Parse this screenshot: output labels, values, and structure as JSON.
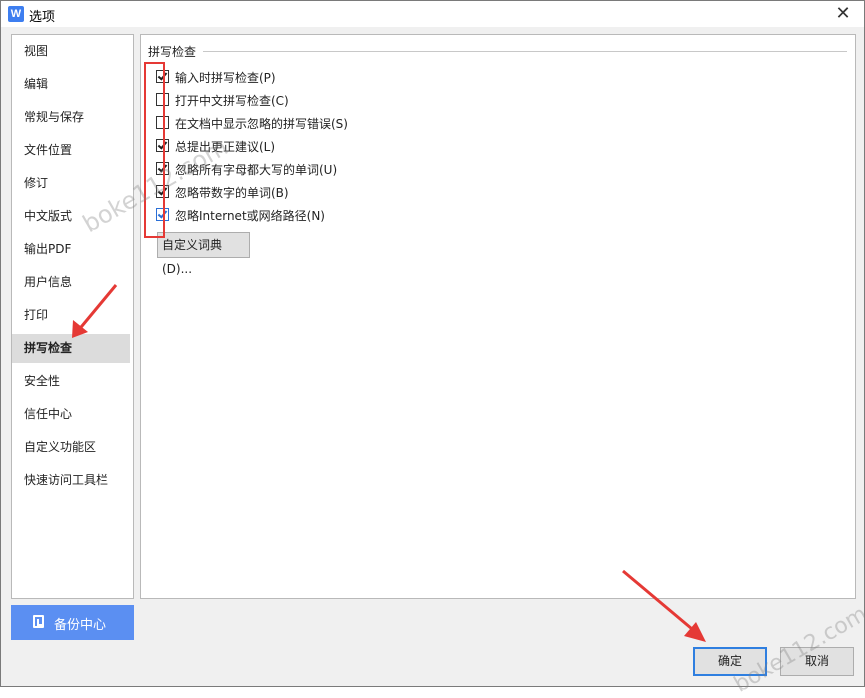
{
  "window": {
    "title": "选项",
    "app_icon": "W",
    "close_glyph": "✕"
  },
  "sidebar": {
    "items": [
      {
        "label": "视图"
      },
      {
        "label": "编辑"
      },
      {
        "label": "常规与保存"
      },
      {
        "label": "文件位置"
      },
      {
        "label": "修订"
      },
      {
        "label": "中文版式"
      },
      {
        "label": "输出PDF"
      },
      {
        "label": "用户信息"
      },
      {
        "label": "打印"
      },
      {
        "label": "拼写检查",
        "active": true
      },
      {
        "label": "安全性"
      },
      {
        "label": "信任中心"
      },
      {
        "label": "自定义功能区"
      },
      {
        "label": "快速访问工具栏"
      }
    ],
    "backup_button": "备份中心"
  },
  "spellcheck": {
    "group_title": "拼写检查",
    "options": [
      {
        "label": "输入时拼写检查(P)",
        "checked": true
      },
      {
        "label": "打开中文拼写检查(C)",
        "checked": false
      },
      {
        "label": "在文档中显示忽略的拼写错误(S)",
        "checked": false
      },
      {
        "label": "总提出更正建议(L)",
        "checked": true
      },
      {
        "label": "忽略所有字母都大写的单词(U)",
        "checked": true
      },
      {
        "label": "忽略带数字的单词(B)",
        "checked": true
      },
      {
        "label": "忽略Internet或网络路径(N)",
        "checked": true
      }
    ],
    "dict_button": "自定义词典(D)..."
  },
  "footer": {
    "ok": "确定",
    "cancel": "取消"
  },
  "watermark": "boke112.com",
  "colors": {
    "accent": "#5b8ff2",
    "annotation": "#e53935"
  }
}
